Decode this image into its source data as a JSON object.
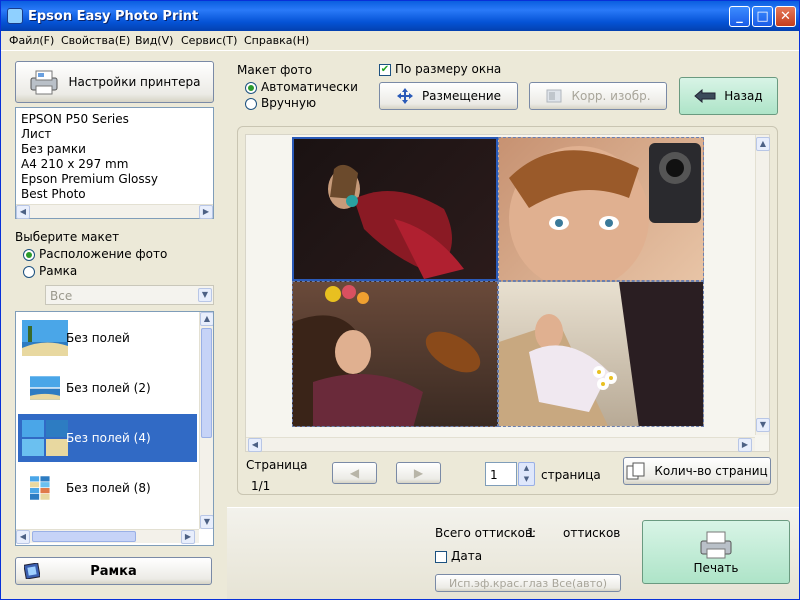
{
  "window": {
    "title": "Epson Easy Photo Print"
  },
  "menu": [
    "Файл(F)",
    "Свойства(E)",
    "Вид(V)",
    "Сервис(T)",
    "Справка(H)"
  ],
  "printer": {
    "settings_label": "Настройки принтера",
    "info": [
      "EPSON P50 Series",
      "Лист",
      "Без рамки",
      "A4 210 x 297 mm",
      "Epson Premium Glossy",
      "Best Photo"
    ]
  },
  "layout_select": {
    "heading": "Выберите макет",
    "option_photo": "Расположение фото",
    "option_frame": "Рамка",
    "filter_value": "Все",
    "items": [
      "Без полей",
      "Без полей (2)",
      "Без полей (4)",
      "Без полей (8)"
    ],
    "selected_index": 2
  },
  "frame_button": "Рамка",
  "photo_layout": {
    "heading": "Макет фото",
    "auto": "Автоматически",
    "manual": "Вручную",
    "fit_window": "По размеру окна",
    "placement_button": "Размещение",
    "correct_button": "Корр. изобр.",
    "back_button": "Назад"
  },
  "page": {
    "label": "Страница",
    "indicator": "1/1",
    "count_value": "1",
    "count_label": "страница",
    "pages_button": "Колич-во страниц"
  },
  "bottom": {
    "total_label": "Всего оттисков:",
    "total_value": "1",
    "total_unit": "оттисков",
    "date_label": "Дата",
    "effect_button": "Исп.эф.крас.глаз Все(авто)",
    "print_button": "Печать"
  },
  "colors": {
    "title_bar": "#0553d6",
    "selection": "#316ac5",
    "print_button": "#aee4c8"
  }
}
